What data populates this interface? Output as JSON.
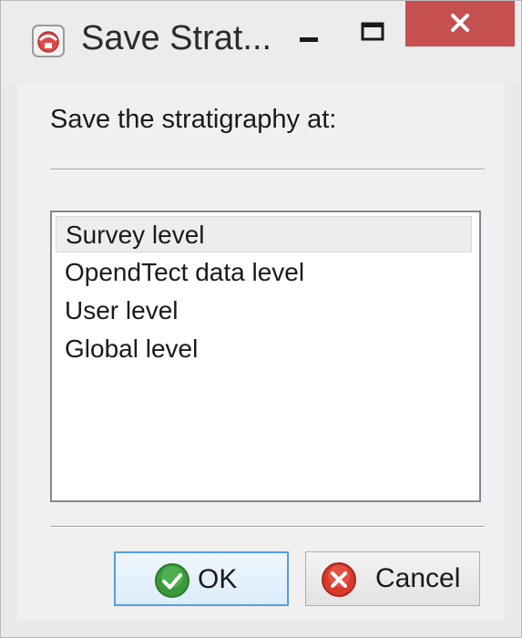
{
  "window": {
    "title": "Save Strat...",
    "app_icon": "opendtect-app-icon",
    "controls": {
      "minimize_icon": "minimize-icon",
      "maximize_icon": "maximize-icon",
      "close_icon": "close-icon",
      "close_color": "#c75050"
    }
  },
  "dialog": {
    "prompt": "Save the stratigraphy at:",
    "levels": [
      {
        "label": "Survey level",
        "selected": true
      },
      {
        "label": "OpendTect data level",
        "selected": false
      },
      {
        "label": "User level",
        "selected": false
      },
      {
        "label": "Global level",
        "selected": false
      }
    ],
    "buttons": {
      "ok": {
        "label": "OK",
        "icon": "checkmark-icon",
        "icon_color": "#3a9a3a",
        "focused": true
      },
      "cancel": {
        "label": "Cancel",
        "icon": "cancel-x-icon",
        "icon_color": "#d8392b"
      }
    }
  }
}
